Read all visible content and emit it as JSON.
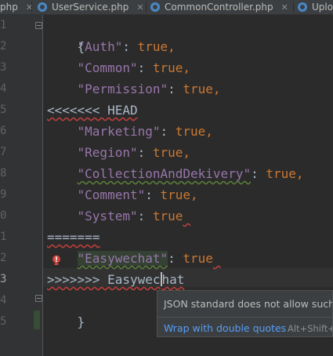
{
  "tabs": [
    {
      "label": "php"
    },
    {
      "label": "UserService.php"
    },
    {
      "label": "CommonController.php"
    },
    {
      "label": "Uplo"
    }
  ],
  "gutter": {
    "line_numbers": [
      "1",
      "2",
      "3",
      "4",
      "5",
      "6",
      "7",
      "8",
      "9",
      "0",
      "1",
      "2",
      "3",
      "4",
      "5"
    ],
    "current_line": "3"
  },
  "code": {
    "l1": "{",
    "l2_key": "\"Auth\"",
    "l2_rest": ": ",
    "l2_val": "true",
    "l2_end": ",",
    "l3_key": "\"Common\"",
    "l3_rest": ": ",
    "l3_val": "true",
    "l3_end": ",",
    "l4_key": "\"Permission\"",
    "l4_rest": ": ",
    "l4_val": "true",
    "l4_end": ",",
    "l5": "<<<<<<< HEAD",
    "l6_key": "\"Marketing\"",
    "l6_rest": ": ",
    "l6_val": "true",
    "l6_end": ",",
    "l7_key": "\"Region\"",
    "l7_rest": ": ",
    "l7_val": "true",
    "l7_end": ",",
    "l8_key": "\"CollectionAndDekivery\"",
    "l8_rest": ": ",
    "l8_val": "true",
    "l8_end": ",",
    "l9_key": "\"Comment\"",
    "l9_rest": ": ",
    "l9_val": "true",
    "l9_end": ",",
    "l10_key": "\"System\"",
    "l10_rest": ": ",
    "l10_val": "true",
    "l11": "=======",
    "l12_key": "\"Easywechat\"",
    "l12_rest": ": ",
    "l12_val": "true",
    "l13_a": ">>>>>>> Easywec",
    "l13_b": "hat",
    "l14": "}"
  },
  "popup": {
    "message": "JSON standard does not allow such t",
    "action": "Wrap with double quotes",
    "shortcut": "Alt+Shift+"
  },
  "colors": {
    "background": "#2b2b2b",
    "key": "#9876aa",
    "keyword": "#cc7832",
    "text": "#a9b7c6",
    "link": "#589df6",
    "error": "#bc3f3c"
  }
}
